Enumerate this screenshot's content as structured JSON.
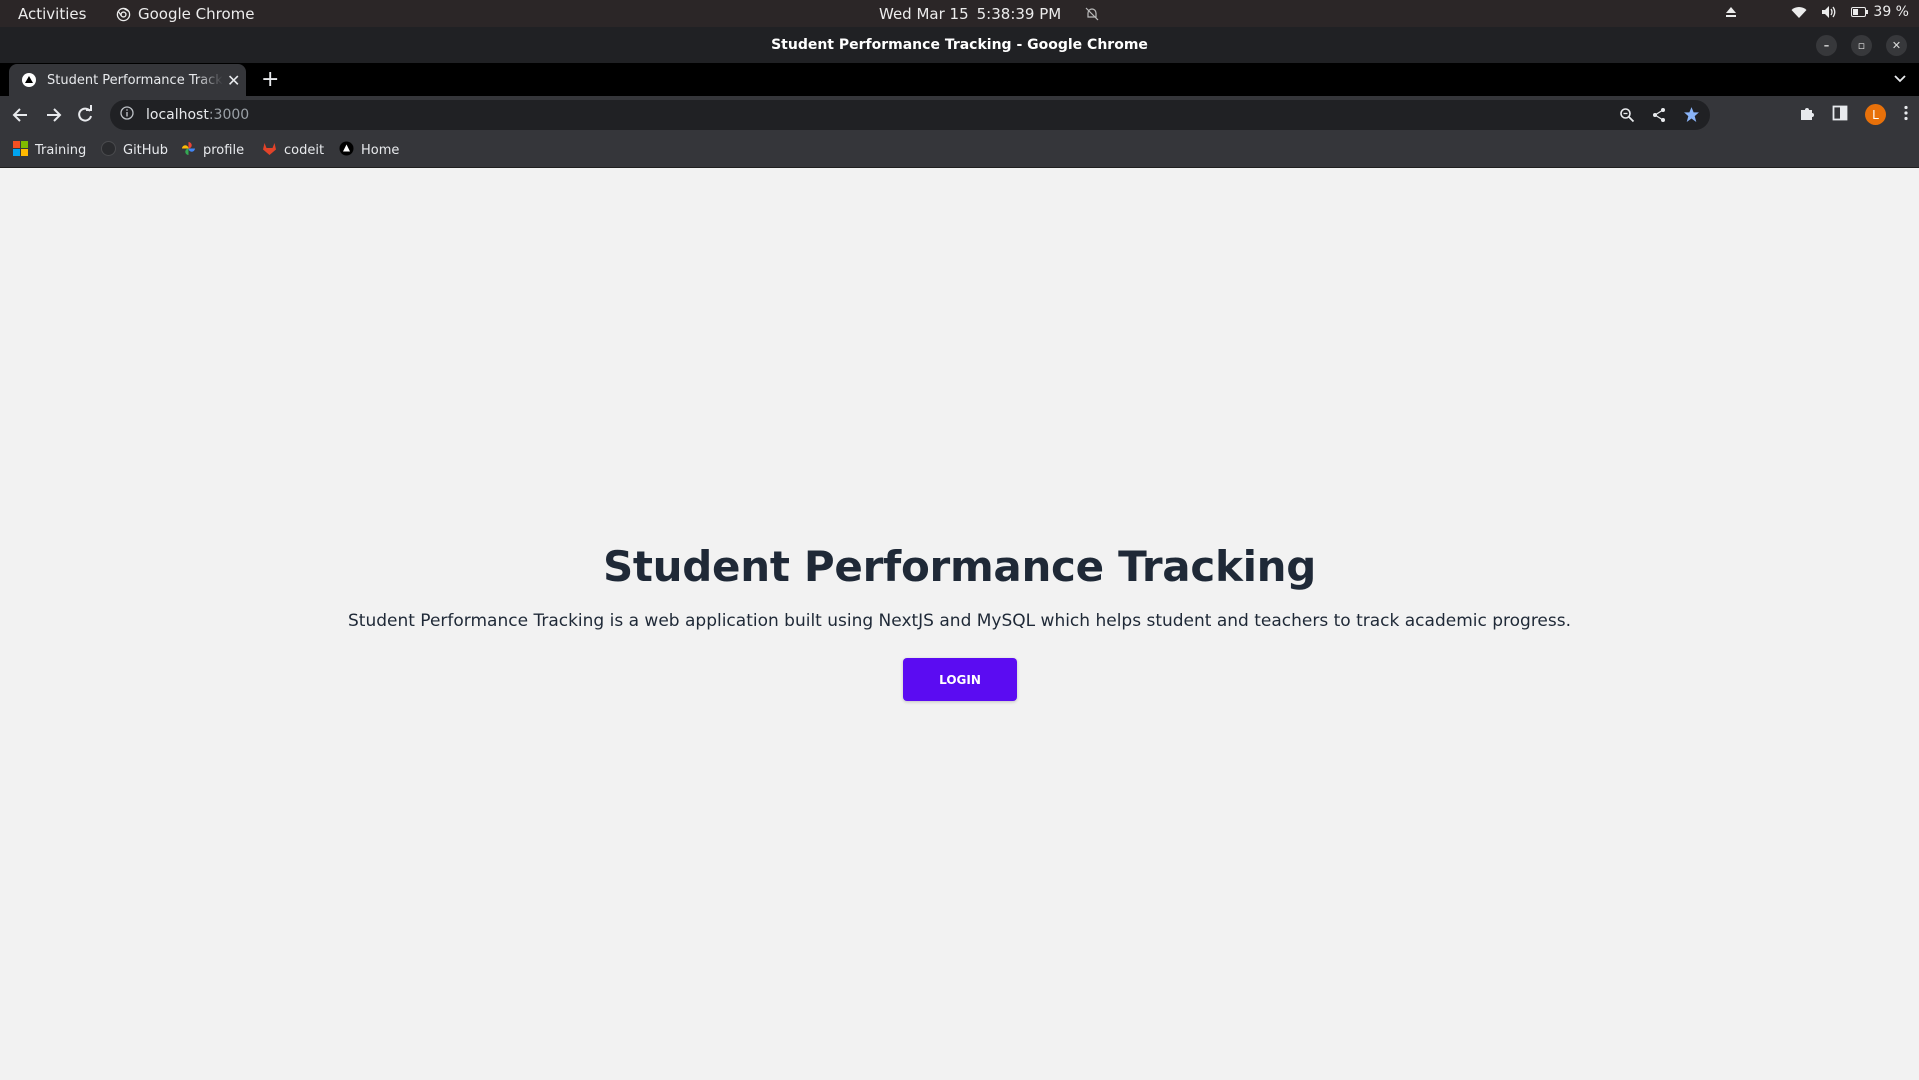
{
  "os_bar": {
    "activities": "Activities",
    "app_name": "Google Chrome",
    "date": "Wed Mar 15",
    "time": "5:38:39 PM",
    "battery": "39 %"
  },
  "window": {
    "title": "Student Performance Tracking - Google Chrome"
  },
  "tabs": [
    {
      "label": "Student Performance Tracking",
      "active": true
    }
  ],
  "address_bar": {
    "host": "localhost",
    "port": ":3000"
  },
  "profile": {
    "initial": "L",
    "color": "#e8710a"
  },
  "bookmarks": [
    {
      "label": "Training",
      "icon": "microsoft-icon"
    },
    {
      "label": "GitHub",
      "icon": "github-icon"
    },
    {
      "label": "profile",
      "icon": "pinwheel-icon"
    },
    {
      "label": "codeit",
      "icon": "gitlab-icon"
    },
    {
      "label": "Home",
      "icon": "triangle-icon"
    }
  ],
  "page": {
    "title": "Student Performance Tracking",
    "description": "Student Performance Tracking is a web application built using NextJS and MySQL which helps student and teachers to track academic progress.",
    "login_label": "LOGIN",
    "accent_color": "#5b0cf2"
  }
}
